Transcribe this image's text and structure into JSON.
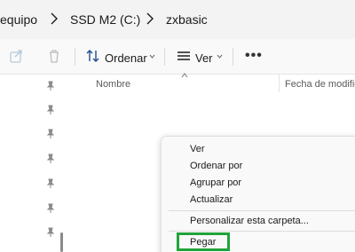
{
  "breadcrumb": {
    "items": [
      "equipo",
      "SSD M2 (C:)",
      "zxbasic"
    ]
  },
  "toolbar": {
    "sort_label": "Ordenar",
    "view_label": "Ver"
  },
  "columns": {
    "name": "Nombre",
    "date": "Fecha de modific"
  },
  "context_menu": {
    "items": [
      "Ver",
      "Ordenar por",
      "Agrupar por",
      "Actualizar",
      "Personalizar esta carpeta...",
      "Pegar"
    ]
  },
  "colors": {
    "highlight": "#21a33a",
    "menu_background": "#f9f9f9"
  }
}
